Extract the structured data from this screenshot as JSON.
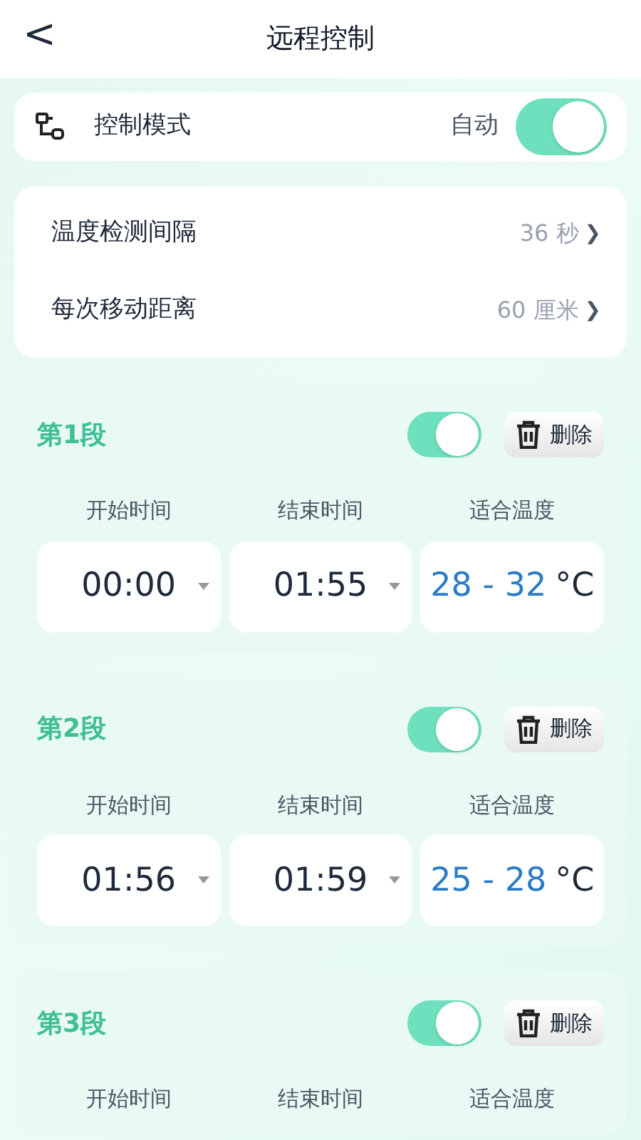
{
  "header": {
    "title": "远程控制",
    "back": "<"
  },
  "mode": {
    "label": "控制模式",
    "value": "自动",
    "on": true
  },
  "settings": [
    {
      "label": "温度检测间隔",
      "value": "36 秒",
      "chevron": "❯"
    },
    {
      "label": "每次移动距离",
      "value": "60 厘米",
      "chevron": "❯"
    }
  ],
  "segments": [
    {
      "title": "第1段",
      "on": true,
      "delete": "删除",
      "labels": [
        "开始时间",
        "结束时间",
        "适合温度"
      ],
      "start": "00:00",
      "end": "01:55",
      "temp_low": "28",
      "temp_sep": "-",
      "temp_high": "32",
      "unit": "°C"
    },
    {
      "title": "第2段",
      "on": true,
      "delete": "删除",
      "labels": [
        "开始时间",
        "结束时间",
        "适合温度"
      ],
      "start": "01:56",
      "end": "01:59",
      "temp_low": "25",
      "temp_sep": "-",
      "temp_high": "28",
      "unit": "°C"
    },
    {
      "title": "第3段",
      "on": true,
      "delete": "删除",
      "labels": [
        "开始时间",
        "结束时间",
        "适合温度"
      ]
    }
  ]
}
